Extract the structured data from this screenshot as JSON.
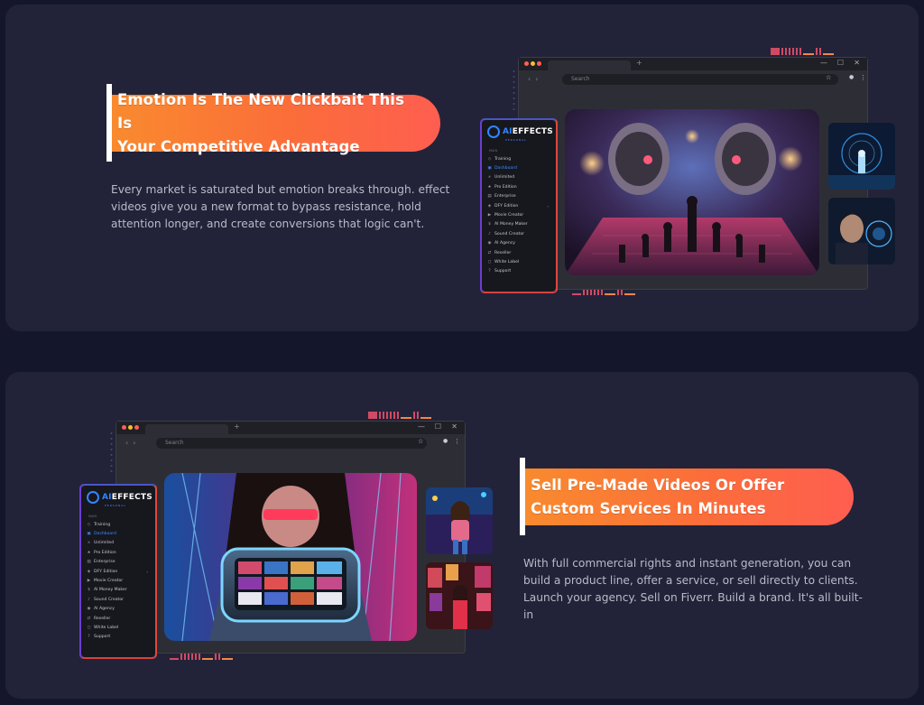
{
  "section1": {
    "headline": "Emotion Is The New Clickbait This Is\nYour Competitive Advantage",
    "body": "Every market is saturated but emotion breaks through. effect videos give you a new format to bypass resistance, hold attention longer, and create conversions that logic can't."
  },
  "section2": {
    "headline": "Sell Pre-Made Videos Or Offer\nCustom Services In Minutes",
    "body": "With full commercial rights and instant generation, you can build a product line, offer a service, or sell directly to clients. Launch your agency. Sell on Fiverr. Build a brand. It's all built-in"
  },
  "browser": {
    "search_placeholder": "Search",
    "new_tab": "+",
    "minimize": "—",
    "maximize": "☐",
    "close": "✕",
    "back": "‹",
    "forward": "›",
    "star_icon": "☆",
    "profile_icon": "👤",
    "menu_icon": "⋮"
  },
  "app_sidebar": {
    "logo_ai": "AI",
    "logo_effects": "EFFECTS",
    "logo_sub": "PERSONAL",
    "collapse_icon": "‹",
    "section_label": "MAIN",
    "items": [
      {
        "label": "Training",
        "icon": "◇",
        "active": false
      },
      {
        "label": "Dashboard",
        "icon": "▣",
        "active": true
      },
      {
        "label": "Unlimited",
        "icon": "∞",
        "active": false
      },
      {
        "label": "Pro Edition",
        "icon": "★",
        "active": false
      },
      {
        "label": "Enterprise",
        "icon": "▤",
        "active": false
      },
      {
        "label": "DFY Edition",
        "icon": "◈",
        "active": false,
        "has_children": true
      },
      {
        "label": "Movie Creator",
        "icon": "▶",
        "active": false
      },
      {
        "label": "AI Money Maker",
        "icon": "$",
        "active": false
      },
      {
        "label": "Sound Creator",
        "icon": "♪",
        "active": false
      },
      {
        "label": "AI Agency",
        "icon": "◉",
        "active": false
      },
      {
        "label": "Reseller",
        "icon": "⇄",
        "active": false
      },
      {
        "label": "White Label",
        "icon": "◻",
        "active": false
      },
      {
        "label": "Support",
        "icon": "?",
        "active": false
      }
    ],
    "chevron_icon": "›"
  },
  "colors": {
    "page_bg": "#14172b",
    "card_bg": "#222339",
    "pill_start": "#f98a2e",
    "pill_end": "#fe5e50",
    "accent_blue": "#2f86ff"
  }
}
